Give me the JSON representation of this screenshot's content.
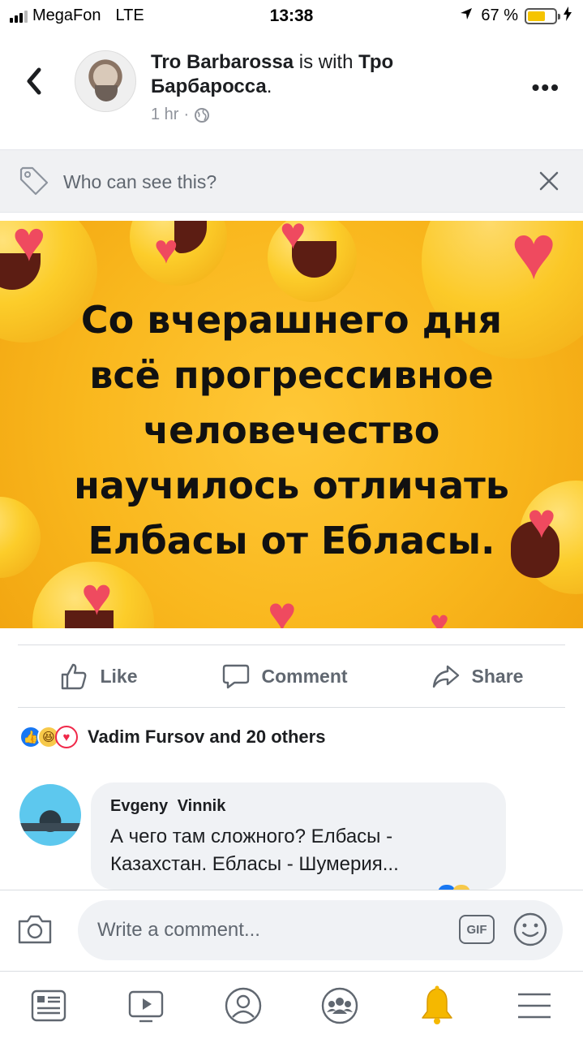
{
  "status_bar": {
    "carrier": "MegaFon",
    "network": "LTE",
    "time": "13:38",
    "battery_text": "67 %",
    "battery_level": 0.67,
    "battery_color": "#f5c400"
  },
  "post": {
    "author": "Tro Barbarossa",
    "with_text": "is with",
    "tagged": "Тро Барбаросса",
    "period": ".",
    "time": "1 hr",
    "separator": "·",
    "audience_icon": "globe-icon",
    "more_label": "•••"
  },
  "privacy": {
    "text": "Who can see this?",
    "icon": "tag-icon"
  },
  "image": {
    "text_lines": [
      "Со вчерашнего дня",
      "всё прогрессивное",
      "человечество",
      "научилось отличать",
      "Елбасы от Ебласы."
    ],
    "background_color": "#f9b71d"
  },
  "actions": {
    "like": "Like",
    "comment": "Comment",
    "share": "Share"
  },
  "reactions": {
    "summary": "Vadim Fursov and 20 others",
    "icons": [
      "like-icon",
      "haha-icon",
      "love-icon"
    ]
  },
  "comment": {
    "author": "Evgeny Vinnik",
    "text": "А чего там сложного? Елбасы - Казахстан. Ебласы - Шумерия..."
  },
  "composer": {
    "placeholder": "Write a comment...",
    "gif_label": "GIF"
  },
  "tabs": [
    "news-feed-icon",
    "watch-icon",
    "profile-icon",
    "groups-icon",
    "notifications-icon",
    "menu-icon"
  ],
  "colors": {
    "accent": "#1877f2",
    "secondary_text": "#606770",
    "notification_bell": "#f5b800"
  }
}
